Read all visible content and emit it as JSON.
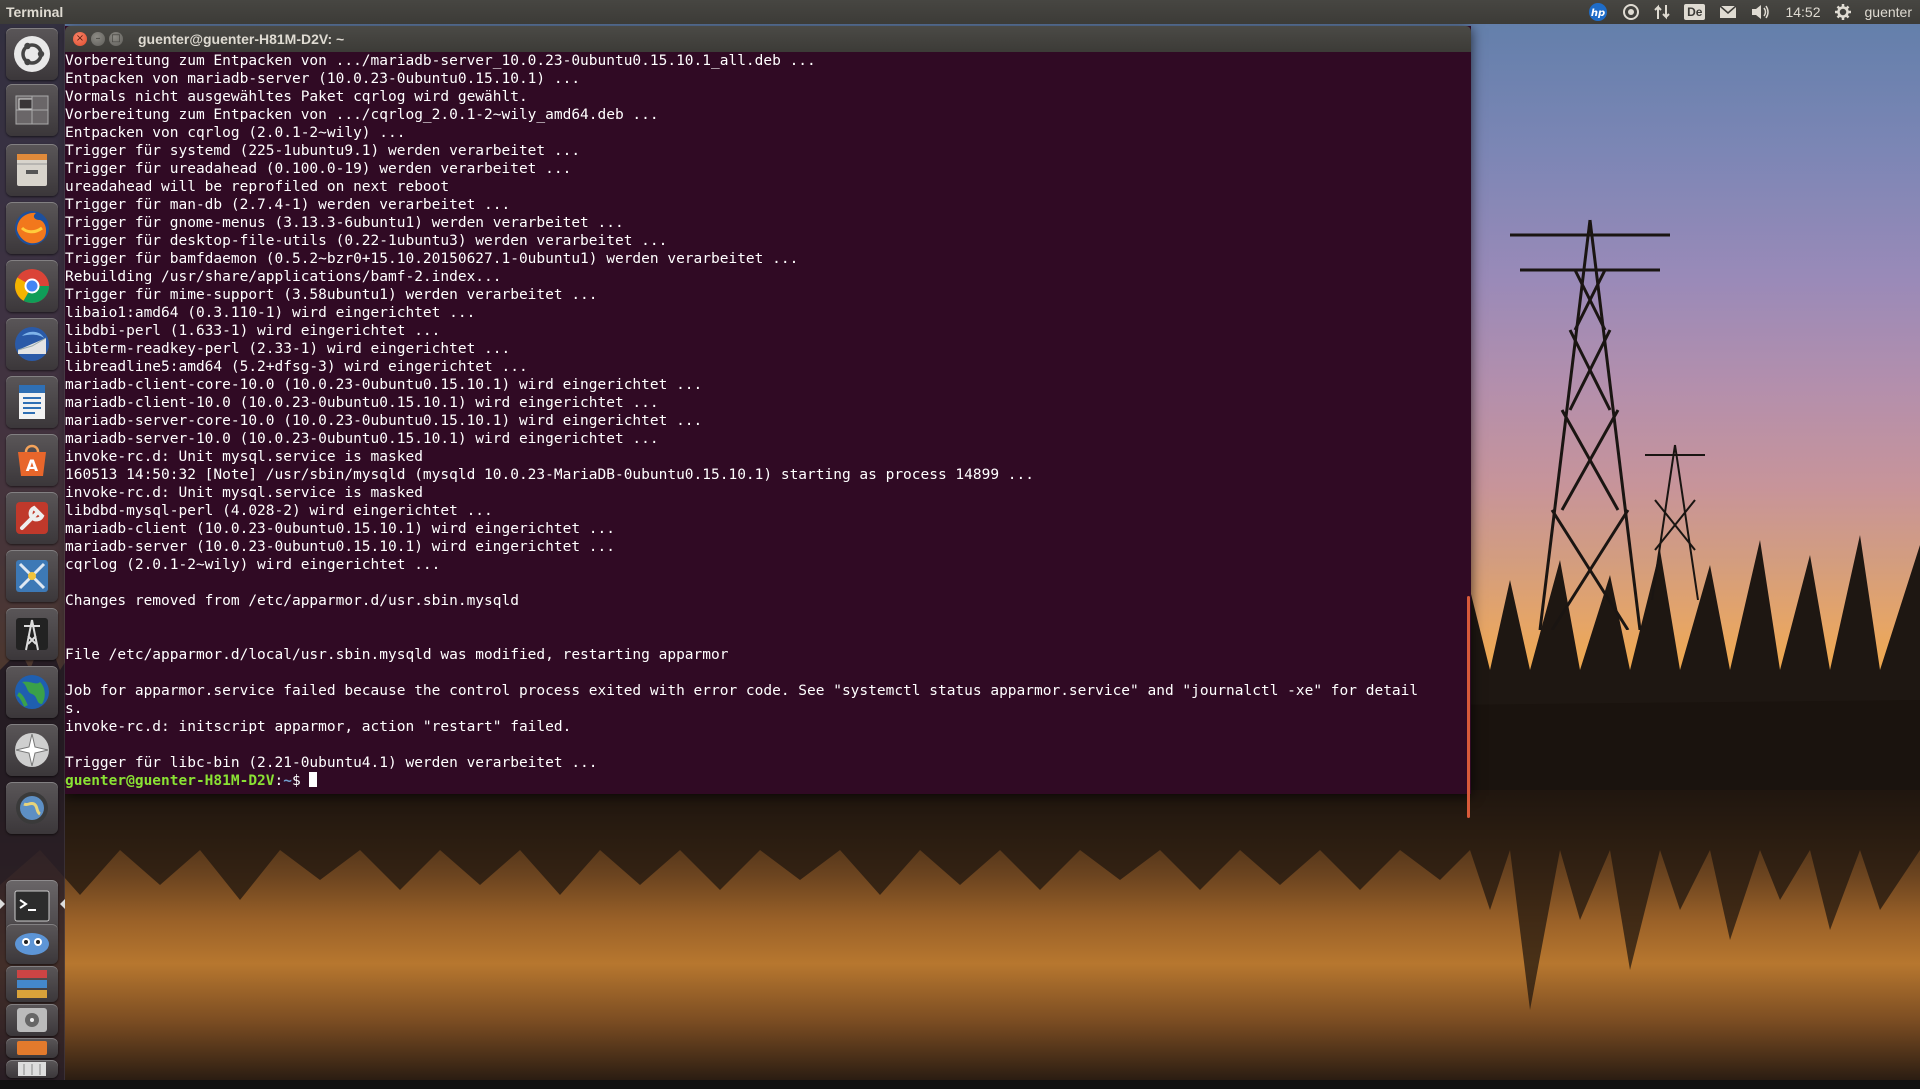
{
  "top_panel": {
    "app_title": "Terminal",
    "clock": "14:52",
    "keyboard_layout": "De",
    "user_name": "guenter",
    "indicators": [
      "hp-icon",
      "network-icon",
      "transfer-icon",
      "keyboard-icon",
      "mail-icon",
      "volume-icon",
      "session-gear-icon"
    ]
  },
  "launcher": {
    "items": [
      {
        "name": "dash-home",
        "icon": "ubuntu-logo-icon"
      },
      {
        "name": "workspace-switcher",
        "icon": "workspace-icon"
      },
      {
        "name": "files",
        "icon": "file-cabinet-icon"
      },
      {
        "name": "firefox",
        "icon": "firefox-icon"
      },
      {
        "name": "chrome",
        "icon": "chrome-icon"
      },
      {
        "name": "thunderbird",
        "icon": "thunderbird-icon"
      },
      {
        "name": "writer",
        "icon": "document-icon"
      },
      {
        "name": "software-center",
        "icon": "software-center-icon"
      },
      {
        "name": "system-tools",
        "icon": "wrench-icon"
      },
      {
        "name": "app-blue",
        "icon": "tools-icon"
      },
      {
        "name": "app-tower",
        "icon": "tower-icon"
      },
      {
        "name": "globe-app",
        "icon": "globe-icon"
      },
      {
        "name": "compass-app",
        "icon": "compass-icon"
      },
      {
        "name": "globe-app-2",
        "icon": "globe-small-icon"
      },
      {
        "name": "terminal",
        "icon": "terminal-icon"
      },
      {
        "name": "app-bot",
        "icon": "robot-icon"
      },
      {
        "name": "app-stack",
        "icon": "stack-icon"
      },
      {
        "name": "app-disk",
        "icon": "disk-icon"
      },
      {
        "name": "app-misc",
        "icon": "misc-icon"
      },
      {
        "name": "trash",
        "icon": "trash-icon"
      }
    ]
  },
  "window": {
    "title": "guenter@guenter-H81M-D2V: ~",
    "close_glyph": "×",
    "min_glyph": "–",
    "max_glyph": "□"
  },
  "terminal": {
    "lines": [
      "Vorbereitung zum Entpacken von .../mariadb-server_10.0.23-0ubuntu0.15.10.1_all.deb ...",
      "Entpacken von mariadb-server (10.0.23-0ubuntu0.15.10.1) ...",
      "Vormals nicht ausgewähltes Paket cqrlog wird gewählt.",
      "Vorbereitung zum Entpacken von .../cqrlog_2.0.1-2~wily_amd64.deb ...",
      "Entpacken von cqrlog (2.0.1-2~wily) ...",
      "Trigger für systemd (225-1ubuntu9.1) werden verarbeitet ...",
      "Trigger für ureadahead (0.100.0-19) werden verarbeitet ...",
      "ureadahead will be reprofiled on next reboot",
      "Trigger für man-db (2.7.4-1) werden verarbeitet ...",
      "Trigger für gnome-menus (3.13.3-6ubuntu1) werden verarbeitet ...",
      "Trigger für desktop-file-utils (0.22-1ubuntu3) werden verarbeitet ...",
      "Trigger für bamfdaemon (0.5.2~bzr0+15.10.20150627.1-0ubuntu1) werden verarbeitet ...",
      "Rebuilding /usr/share/applications/bamf-2.index...",
      "Trigger für mime-support (3.58ubuntu1) werden verarbeitet ...",
      "libaio1:amd64 (0.3.110-1) wird eingerichtet ...",
      "libdbi-perl (1.633-1) wird eingerichtet ...",
      "libterm-readkey-perl (2.33-1) wird eingerichtet ...",
      "libreadline5:amd64 (5.2+dfsg-3) wird eingerichtet ...",
      "mariadb-client-core-10.0 (10.0.23-0ubuntu0.15.10.1) wird eingerichtet ...",
      "mariadb-client-10.0 (10.0.23-0ubuntu0.15.10.1) wird eingerichtet ...",
      "mariadb-server-core-10.0 (10.0.23-0ubuntu0.15.10.1) wird eingerichtet ...",
      "mariadb-server-10.0 (10.0.23-0ubuntu0.15.10.1) wird eingerichtet ...",
      "invoke-rc.d: Unit mysql.service is masked",
      "160513 14:50:32 [Note] /usr/sbin/mysqld (mysqld 10.0.23-MariaDB-0ubuntu0.15.10.1) starting as process 14899 ...",
      "invoke-rc.d: Unit mysql.service is masked",
      "libdbd-mysql-perl (4.028-2) wird eingerichtet ...",
      "mariadb-client (10.0.23-0ubuntu0.15.10.1) wird eingerichtet ...",
      "mariadb-server (10.0.23-0ubuntu0.15.10.1) wird eingerichtet ...",
      "cqrlog (2.0.1-2~wily) wird eingerichtet ...",
      "",
      "Changes removed from /etc/apparmor.d/usr.sbin.mysqld",
      "",
      "",
      "File /etc/apparmor.d/local/usr.sbin.mysqld was modified, restarting apparmor",
      "",
      "Job for apparmor.service failed because the control process exited with error code. See \"systemctl status apparmor.service\" and \"journalctl -xe\" for detail",
      "s.",
      "invoke-rc.d: initscript apparmor, action \"restart\" failed.",
      "",
      "Trigger für libc-bin (2.21-0ubuntu4.1) werden verarbeitet ..."
    ],
    "prompt_user": "guenter@guenter-H81M-D2V",
    "prompt_sep": ":",
    "prompt_path": "~",
    "prompt_dollar": "$ "
  },
  "colors": {
    "terminal_bg": "#300a24",
    "terminal_fg": "#ffffff",
    "prompt_user": "#8ae234",
    "prompt_path": "#729fcf",
    "panel_bg": "#3c3b37"
  }
}
